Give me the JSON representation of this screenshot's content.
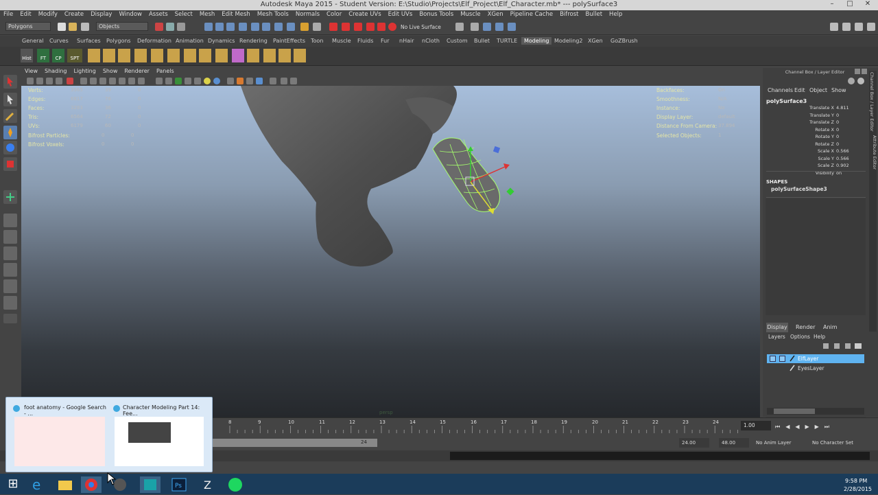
{
  "window": {
    "title": "Autodesk Maya 2015 - Student Version: E:\\Studio\\Projects\\Elf_Project\\Elf_Character.mb*  ---  polySurface3"
  },
  "menubar": [
    "File",
    "Edit",
    "Modify",
    "Create",
    "Display",
    "Window",
    "Assets",
    "Select",
    "Mesh",
    "Edit Mesh",
    "Mesh Tools",
    "Normals",
    "Color",
    "Create UVs",
    "Edit UVs",
    "Bonus Tools",
    "Muscle",
    "XGen",
    "Pipeline Cache",
    "Bifrost",
    "Bullet",
    "Help"
  ],
  "statusline": {
    "mode": "Polygons",
    "objects_label": "Objects",
    "live_surface": "No Live Surface"
  },
  "shelf_tabs": [
    "General",
    "Curves",
    "Surfaces",
    "Polygons",
    "Deformation",
    "Animation",
    "Dynamics",
    "Rendering",
    "PaintEffects",
    "Toon",
    "Muscle",
    "Fluids",
    "Fur",
    "nHair",
    "nCloth",
    "Custom",
    "Bullet",
    "TURTLE",
    "Modeling",
    "Modeling2",
    "XGen",
    "GoZBrush"
  ],
  "shelf_active_tab": "Modeling",
  "shelf_icons": [
    "Hist",
    "FT",
    "CP",
    "SPT"
  ],
  "panel_menu": [
    "View",
    "Shading",
    "Lighting",
    "Show",
    "Renderer",
    "Panels"
  ],
  "hud_left": [
    {
      "label": "Verts:",
      "v1": "3565",
      "v2": "39",
      "v3": "0"
    },
    {
      "label": "Edges:",
      "v1": "6817",
      "v2": "76",
      "v3": "0"
    },
    {
      "label": "Faces:",
      "v1": "3283",
      "v2": "36",
      "v3": "0"
    },
    {
      "label": "Tris:",
      "v1": "6564",
      "v2": "72",
      "v3": "0"
    },
    {
      "label": "UVs:",
      "v1": "6179",
      "v2": "60",
      "v3": "0"
    },
    {
      "label": "Bifrost Particles:",
      "v1": "0",
      "v2": "0",
      "v3": ""
    },
    {
      "label": "Bifrost Voxels:",
      "v1": "0",
      "v2": "0",
      "v3": ""
    }
  ],
  "hud_right": [
    {
      "label": "Backfaces:",
      "value": "On"
    },
    {
      "label": "Smoothness:",
      "value": "N/A"
    },
    {
      "label": "Instance:",
      "value": "No"
    },
    {
      "label": "Display Layer:",
      "value": "default"
    },
    {
      "label": "Distance From Camera:",
      "value": "37.894"
    },
    {
      "label": "Selected Objects:",
      "value": "1"
    }
  ],
  "viewport_camera_label": "persp",
  "channelbox": {
    "header": "Channel Box / Layer Editor",
    "menu": [
      "Channels",
      "Edit",
      "Object",
      "Show"
    ],
    "object_name": "polySurface3",
    "attributes": [
      {
        "name": "Translate X",
        "value": "4.811"
      },
      {
        "name": "Translate Y",
        "value": "0"
      },
      {
        "name": "Translate Z",
        "value": "0"
      },
      {
        "name": "Rotate X",
        "value": "0"
      },
      {
        "name": "Rotate Y",
        "value": "0"
      },
      {
        "name": "Rotate Z",
        "value": "0"
      },
      {
        "name": "Scale X",
        "value": "0.566"
      },
      {
        "name": "Scale Y",
        "value": "0.566"
      },
      {
        "name": "Scale Z",
        "value": "0.902"
      },
      {
        "name": "Visibility",
        "value": "on"
      }
    ],
    "shapes_label": "SHAPES",
    "shape_name": "polySurfaceShape3",
    "side_tabs": [
      "Channel Box / Layer Editor",
      "Attribute Editor"
    ]
  },
  "layer_editor": {
    "tabs": [
      "Display",
      "Render",
      "Anim"
    ],
    "menu": [
      "Layers",
      "Options",
      "Help"
    ],
    "layers": [
      {
        "name": "ElfLayer",
        "selected": true
      },
      {
        "name": "EyesLayer",
        "selected": false
      }
    ]
  },
  "timeline": {
    "ticks": [
      "8",
      "9",
      "10",
      "11",
      "12",
      "13",
      "14",
      "15",
      "16",
      "17",
      "18",
      "19",
      "20",
      "21",
      "22",
      "23",
      "24"
    ],
    "current": "1.00"
  },
  "range": {
    "end_marker": "24",
    "start": "24.00",
    "end": "48.00",
    "anim_layer": "No Anim Layer",
    "char_set": "No Character Set"
  },
  "previews": [
    {
      "title": "foot anatomy - Google Search - ..."
    },
    {
      "title": "Character Modeling Part 14: Fee..."
    }
  ],
  "clock": {
    "time": "9:58 PM",
    "date": "2/28/2015"
  },
  "colors": {
    "accent": "#5fb3f0",
    "mesh_wire": "#a6ff6c",
    "taskbar": "#1b3c5a"
  }
}
